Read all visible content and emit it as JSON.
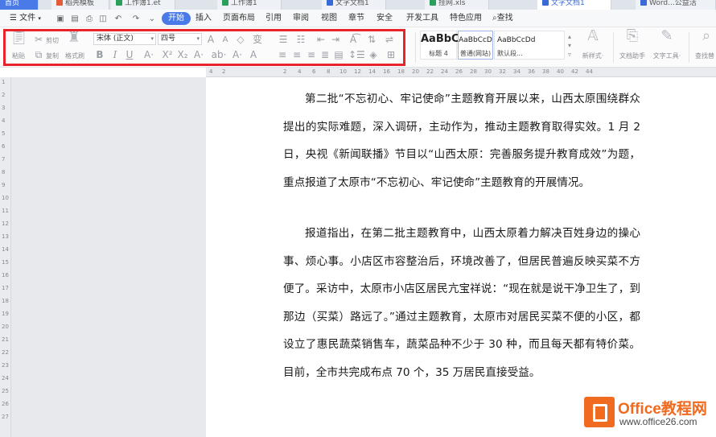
{
  "doc_tabs": [
    {
      "label": "首页",
      "type": "home"
    },
    {
      "label": "稻壳模板",
      "type": "normal",
      "color": "#e45b3a"
    },
    {
      "label": "工作簿1.et",
      "type": "normal",
      "color": "#2aa05a"
    },
    {
      "label": "工作簿1",
      "type": "normal",
      "color": "#2aa05a"
    },
    {
      "label": "文字文档1",
      "type": "normal",
      "color": "#3a6ad8"
    },
    {
      "label": "挂网.xls",
      "type": "normal",
      "color": "#2aa05a"
    },
    {
      "label": "文字文档1",
      "type": "active",
      "color": "#3a6ad8"
    },
    {
      "label": "Word...公益活",
      "type": "normal",
      "color": "#3a6ad8"
    }
  ],
  "menubar": {
    "file_label": "文件",
    "menu_icon": "hamburger-icon",
    "quick_access": [
      "save-icon",
      "export-pdf-icon",
      "print-icon",
      "print-preview-icon",
      "undo-icon",
      "redo-icon",
      "customize-icon"
    ],
    "tabs": [
      "开始",
      "插入",
      "页面布局",
      "引用",
      "审阅",
      "视图",
      "章节",
      "安全",
      "开发工具",
      "特色应用"
    ],
    "active_tab": "开始",
    "search_label": "查找"
  },
  "ribbon": {
    "paste_label": "粘贴",
    "cut_label": "剪切",
    "copy_label": "复制",
    "format_painter_label": "格式刷",
    "font_name": "宋体 (正文)",
    "font_size": "四号",
    "styles": [
      {
        "sample": "AaBbC",
        "name": "标题 4"
      },
      {
        "sample": "AaBbCcD",
        "name": "普通(网站)"
      },
      {
        "sample": "AaBbCcDd",
        "name": "默认段..."
      }
    ],
    "new_style_label": "新样式",
    "doc_assistant_label": "文档助手",
    "text_tools_label": "文字工具",
    "find_replace_label": "查找替",
    "highlight_color": "#e8232b",
    "active_tab_color": "#4a7ae8"
  },
  "ruler": {
    "h_ticks": [
      "4",
      "2",
      "2",
      "4",
      "6",
      "8",
      "10",
      "12",
      "14",
      "16",
      "18",
      "20",
      "22",
      "24",
      "26",
      "28",
      "30",
      "32",
      "34",
      "36",
      "38",
      "40",
      "42",
      "44"
    ],
    "v_ticks": [
      "1",
      "2",
      "3",
      "4",
      "5",
      "6",
      "7",
      "8",
      "9",
      "10",
      "11",
      "12",
      "13",
      "14",
      "15",
      "16",
      "17",
      "18",
      "19",
      "20",
      "21",
      "22",
      "23",
      "24",
      "25",
      "26",
      "27"
    ]
  },
  "document": {
    "paragraphs": [
      "第二批“不忘初心、牢记使命”主题教育开展以来，山西太原围绕群众提出的实际难题，深入调研，主动作为，推动主题教育取得实效。1 月 2 日，央视《新闻联播》节目以“山西太原：完善服务提升教育成效”为题，重点报道了太原市“不忘初心、牢记使命”主题教育的开展情况。",
      "报道指出，在第二批主题教育中，山西太原着力解决百姓身边的操心事、烦心事。小店区市容整治后，环境改善了，但居民普遍反映买菜不方便了。采访中，太原市小店区居民亢宝祥说：“现在就是说干净卫生了，到那边（买菜）路远了。”通过主题教育，太原市对居民买菜不便的小区，都设立了惠民蔬菜销售车，蔬菜品种不少于 30 种，而且每天都有特价菜。目前，全市共完成布点 70 个，35 万居民直接受益。"
    ]
  },
  "watermark": {
    "title": "Office教程网",
    "url": "www.office26.com",
    "color": "#f06a20"
  }
}
